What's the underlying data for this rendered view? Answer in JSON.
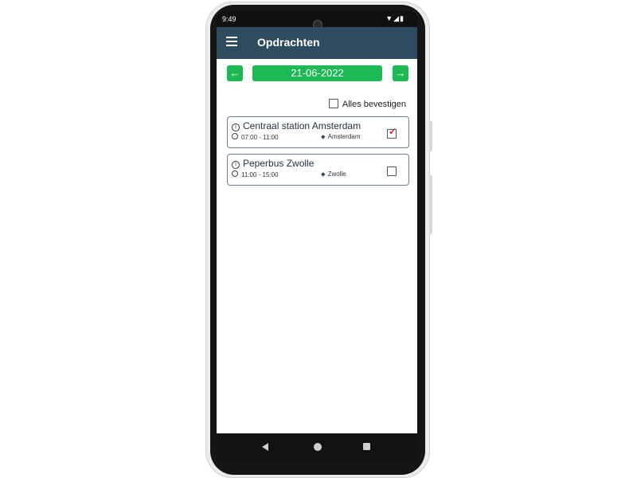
{
  "status_bar": {
    "time": "9:49",
    "icons": [
      "wifi-icon",
      "signal-icon",
      "battery-icon"
    ]
  },
  "app_bar": {
    "title": "Opdrachten"
  },
  "date_nav": {
    "date": "21-06-2022"
  },
  "confirm_all": {
    "label": "Alles bevestigen",
    "checked": false
  },
  "assignments": [
    {
      "title": "Centraal station Amsterdam",
      "time": "07:00 - 11:00",
      "location": "Amsterdam",
      "checked": true
    },
    {
      "title": "Peperbus Zwolle",
      "time": "11:00 - 15:00",
      "location": "Zwolle",
      "checked": false
    }
  ],
  "colors": {
    "app_bar": "#2e4b5f",
    "accent_green": "#1db955",
    "check_red": "#e0203a"
  }
}
